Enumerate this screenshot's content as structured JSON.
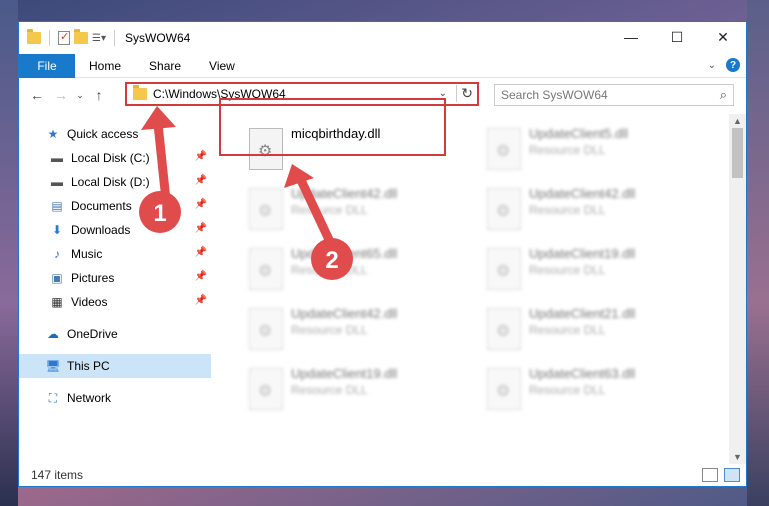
{
  "window": {
    "title": "SysWOW64",
    "controls": {
      "minimize": "—",
      "maximize": "☐",
      "close": "✕"
    }
  },
  "ribbon": {
    "file": "File",
    "tabs": [
      "Home",
      "Share",
      "View"
    ]
  },
  "address": {
    "path": "C:\\Windows\\SysWOW64",
    "search_placeholder": "Search SysWOW64"
  },
  "nav": {
    "quick_access": "Quick access",
    "items": [
      {
        "label": "Local Disk (C:)",
        "icon": "drive-icon"
      },
      {
        "label": "Local Disk (D:)",
        "icon": "drive-icon"
      },
      {
        "label": "Documents",
        "icon": "documents-icon"
      },
      {
        "label": "Downloads",
        "icon": "downloads-icon"
      },
      {
        "label": "Music",
        "icon": "music-icon"
      },
      {
        "label": "Pictures",
        "icon": "pictures-icon"
      },
      {
        "label": "Videos",
        "icon": "videos-icon"
      }
    ],
    "onedrive": "OneDrive",
    "this_pc": "This PC",
    "network": "Network"
  },
  "files": {
    "highlighted": {
      "name": "micqbirthday.dll"
    },
    "blurred": [
      {
        "name": "UpdateClient5.dll",
        "type": "Resource DLL"
      },
      {
        "name": "UpdateClient42.dll",
        "type": "Resource DLL"
      },
      {
        "name": "UpdateClient42.dll",
        "type": "Resource DLL"
      },
      {
        "name": "UpdateClient65.dll",
        "type": "Resource DLL"
      },
      {
        "name": "UpdateClient19.dll",
        "type": "Resource DLL"
      },
      {
        "name": "UpdateClient42.dll",
        "type": "Resource DLL"
      },
      {
        "name": "UpdateClient21.dll",
        "type": "Resource DLL"
      },
      {
        "name": "UpdateClient19.dll",
        "type": "Resource DLL"
      },
      {
        "name": "UpdateClient63.dll",
        "type": "Resource DLL"
      }
    ]
  },
  "status": {
    "count": "147 items"
  },
  "annotations": {
    "step1": "1",
    "step2": "2",
    "color": "#e04b4b"
  }
}
